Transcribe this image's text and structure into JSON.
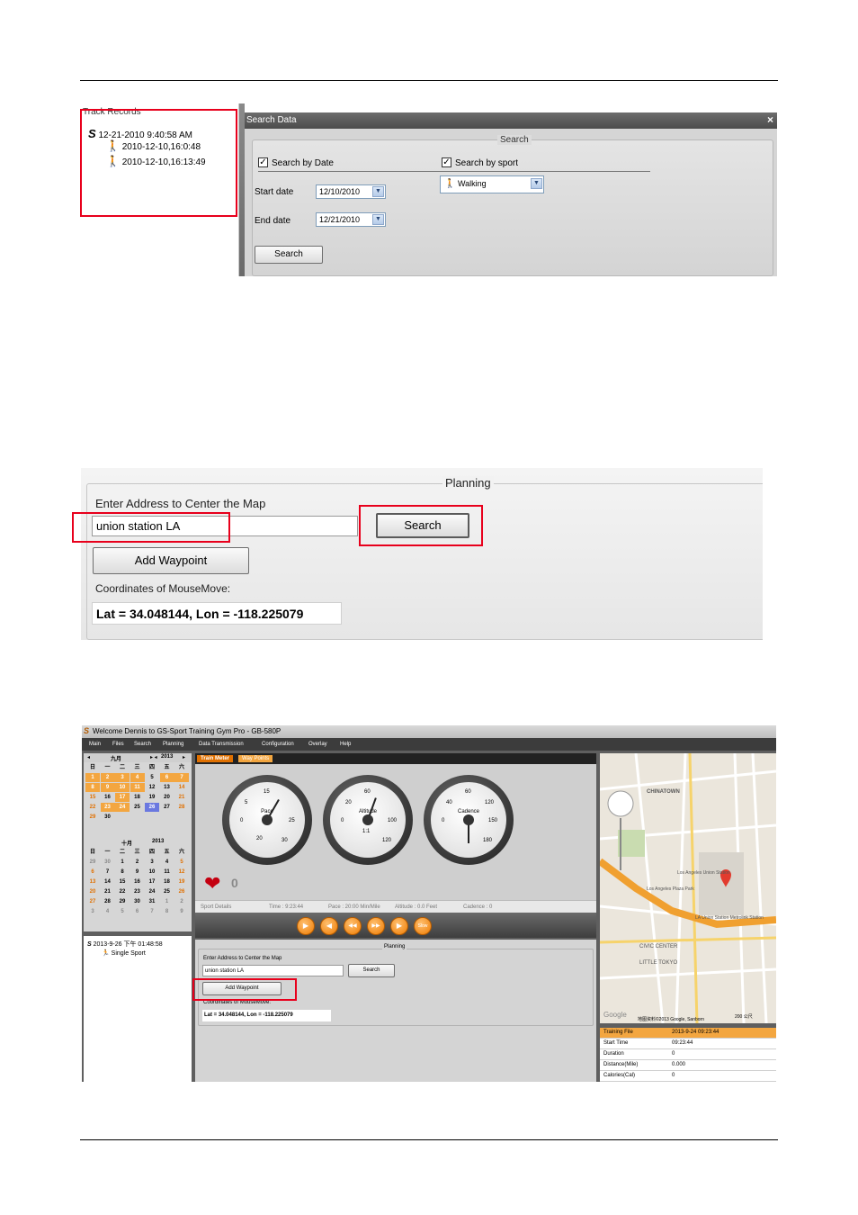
{
  "shot1": {
    "pane_title": "Track Records",
    "tree_root": "12-21-2010 9:40:58 AM",
    "tree_children": [
      "2010-12-10,16:0:48",
      "2010-12-10,16:13:49"
    ],
    "dialog_title": "Search Data",
    "close": "×",
    "group_title": "Search",
    "search_by_date": "Search by Date",
    "search_by_sport": "Search by sport",
    "start_date_label": "Start date",
    "start_date_value": "12/10/2010",
    "end_date_label": "End date",
    "end_date_value": "12/21/2010",
    "sport_value": "Walking",
    "search_button": "Search"
  },
  "shot2": {
    "group_title": "Planning",
    "address_label": "Enter Address to Center the Map",
    "address_value": "union station LA",
    "search_button": "Search",
    "add_waypoint_button": "Add Waypoint",
    "coords_label": "Coordinates of MouseMove:",
    "coords_value": "Lat = 34.048144, Lon = -118.225079"
  },
  "shot3": {
    "window_title": "Welcome Dennis to GS-Sport Training Gym Pro - GB-580P",
    "menu": [
      "Main",
      "Files",
      "Search",
      "Planning",
      "Data Transmission",
      "Configuration",
      "Overlay",
      "Help"
    ],
    "cal1": {
      "month": "九月",
      "year": "2013",
      "weekdays": [
        "日",
        "一",
        "二",
        "三",
        "四",
        "五",
        "六"
      ],
      "days": [
        "1",
        "2",
        "3",
        "4",
        "5",
        "6",
        "7",
        "8",
        "9",
        "10",
        "11",
        "12",
        "13",
        "14",
        "15",
        "16",
        "17",
        "18",
        "19",
        "20",
        "21",
        "22",
        "23",
        "24",
        "25",
        "26",
        "27",
        "28",
        "29",
        "30"
      ]
    },
    "cal2": {
      "month": "十月",
      "year": "2013",
      "weekdays": [
        "日",
        "一",
        "二",
        "三",
        "四",
        "五",
        "六"
      ],
      "days": [
        "29",
        "30",
        "1",
        "2",
        "3",
        "4",
        "5",
        "6",
        "7",
        "8",
        "9",
        "10",
        "11",
        "12",
        "13",
        "14",
        "15",
        "16",
        "17",
        "18",
        "19",
        "20",
        "21",
        "22",
        "23",
        "24",
        "25",
        "26",
        "27",
        "28",
        "29",
        "30",
        "31",
        "1",
        "2",
        "3",
        "4",
        "5",
        "6",
        "7",
        "8",
        "9"
      ]
    },
    "tabs": [
      "Train Meter",
      "Way Points"
    ],
    "gauges": [
      {
        "label": "Pace",
        "nums": [
          "0",
          "5",
          "15",
          "25",
          "20",
          "30"
        ]
      },
      {
        "label": "Altitude",
        "nums": [
          "0",
          "20",
          "60",
          "100",
          "1:1",
          "120"
        ]
      },
      {
        "label": "Cadence",
        "nums": [
          "0",
          "40",
          "60",
          "120",
          "150",
          "180"
        ]
      }
    ],
    "heart_value": "0",
    "status": [
      "Sport Details",
      "Time : 9:23:44",
      "Pace : 20:00 Min/Mile",
      "Altitude : 0.0 Feet",
      "Cadence : 0"
    ],
    "controls": [
      "▶",
      "◀",
      "◀◀",
      "▶▶",
      "▶",
      "Slow"
    ],
    "tree_root": "2013-9-26 下午 01:48:58",
    "tree_child": "Single Sport",
    "planning": {
      "group_title": "Planning",
      "address_label": "Enter Address to Center the Map",
      "address_value": "union station LA",
      "search_button": "Search",
      "add_waypoint_button": "Add Waypoint",
      "coords_label": "Coordinates of MouseMove:",
      "coords_value": "Lat = 34.048144, Lon = -118.225079"
    },
    "map_labels": [
      "CHINATOWN",
      "Los Angeles Union Station",
      "Los Angeles Plaza Park",
      "LA Union Station Metrolink Station",
      "CIVIC CENTER",
      "LITTLE TOKYO",
      "Google",
      "地图资料©2013 Google, Sanborn",
      "200 公尺"
    ],
    "info": [
      {
        "key": "Training File",
        "value": "2013-9-24 09:23:44"
      },
      {
        "key": "Start Time",
        "value": "09:23:44"
      },
      {
        "key": "Duration",
        "value": "0"
      },
      {
        "key": "Distance(Mile)",
        "value": "0.000"
      },
      {
        "key": "Calories(Cal)",
        "value": "0"
      }
    ]
  },
  "colors": {
    "highlight": "#e8001c",
    "accent": "#ee7a00"
  }
}
